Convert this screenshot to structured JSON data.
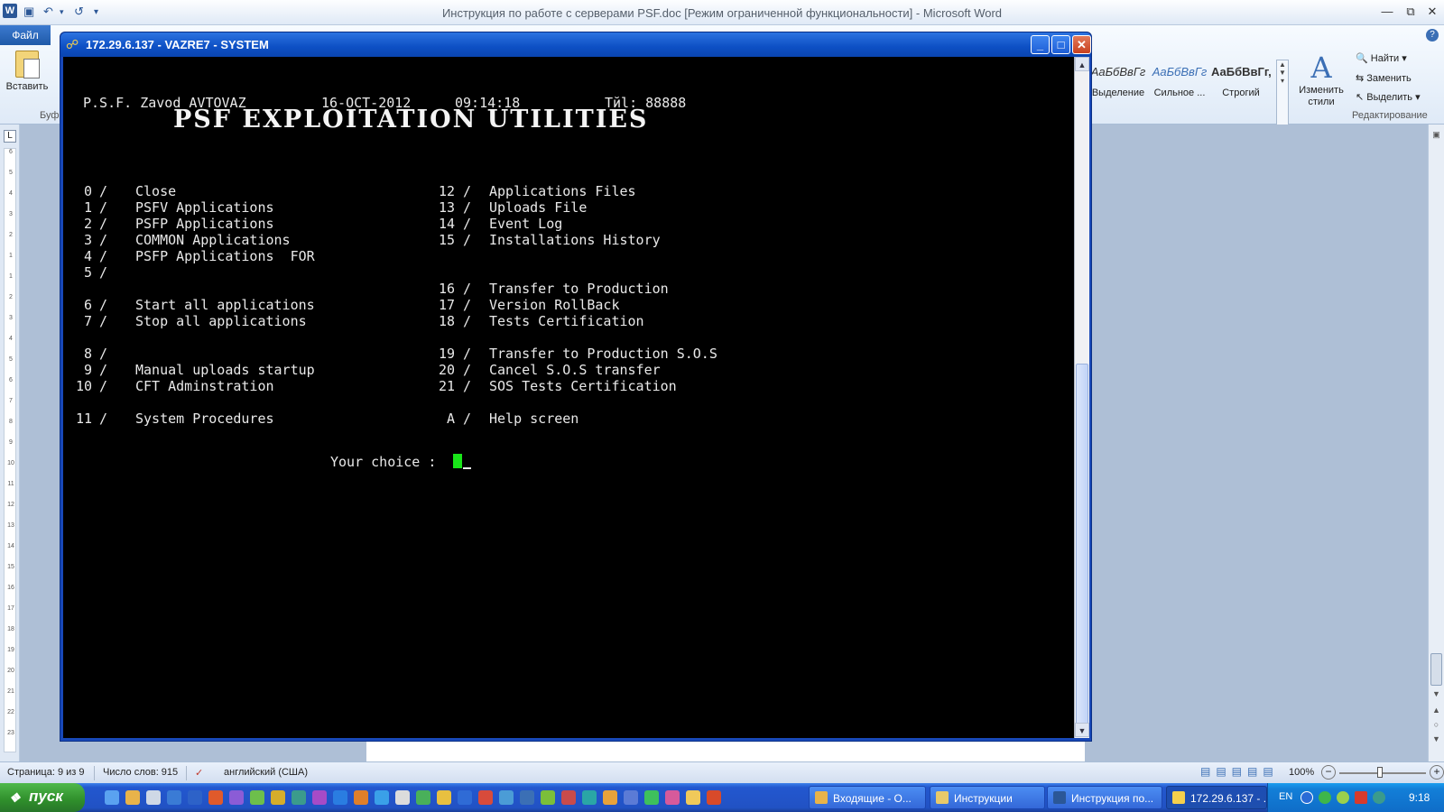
{
  "word": {
    "title": "Инструкция по работе с серверами PSF.doc [Режим ограниченной функциональности]  -  Microsoft Word",
    "file_tab": "Файл",
    "paste_label": "Вставить",
    "clipboard_group": "Буф",
    "styles": [
      {
        "sample": "АаБбВвГг",
        "name": "Выделение"
      },
      {
        "sample": "АаБбВвГг",
        "name": "Сильное ..."
      },
      {
        "sample": "АаБбВвГг,",
        "name": "Строгий"
      }
    ],
    "change_styles": "Изменить стили",
    "edit": {
      "find": "Найти",
      "replace": "Заменить",
      "select": "Выделить",
      "group": "Редактирование"
    },
    "status": {
      "page": "Страница: 9 из 9",
      "words": "Число слов: 915",
      "language": "английский (США)",
      "zoom": "100%"
    },
    "ruler_marks": [
      "6",
      "5",
      "4",
      "3",
      "2",
      "1",
      "1",
      "2",
      "3",
      "4",
      "5",
      "6",
      "7",
      "8",
      "9",
      "10",
      "11",
      "12",
      "13",
      "14",
      "15",
      "16",
      "17",
      "18",
      "19",
      "20",
      "21",
      "22",
      "23"
    ]
  },
  "telnet": {
    "title": "172.29.6.137 - VAZRE7 - SYSTEM",
    "header": {
      "site": "P.S.F. Zavod AVTOVAZ",
      "date": "16-OCT-2012",
      "time": "09:14:18",
      "terminal": "Tйl: 88888"
    },
    "heading": "PSF EXPLOITATION UTILITIES",
    "left_menu": [
      {
        "num": "0",
        "label": "Close"
      },
      {
        "num": "1",
        "label": "PSFV Applications"
      },
      {
        "num": "2",
        "label": "PSFP Applications"
      },
      {
        "num": "3",
        "label": "COMMON Applications"
      },
      {
        "num": "4",
        "label": "PSFP Applications  FOR"
      },
      {
        "num": "5",
        "label": ""
      },
      {
        "num": "6",
        "label": "Start all applications"
      },
      {
        "num": "7",
        "label": "Stop all applications"
      },
      {
        "num": "8",
        "label": ""
      },
      {
        "num": "9",
        "label": "Manual uploads startup"
      },
      {
        "num": "10",
        "label": "CFT Adminstration"
      },
      {
        "num": "11",
        "label": "System Procedures"
      }
    ],
    "right_menu": [
      {
        "num": "12",
        "label": "Applications Files"
      },
      {
        "num": "13",
        "label": "Uploads File"
      },
      {
        "num": "14",
        "label": "Event Log"
      },
      {
        "num": "15",
        "label": "Installations History"
      },
      {
        "num": "16",
        "label": "Transfer to Production"
      },
      {
        "num": "17",
        "label": "Version RollBack"
      },
      {
        "num": "18",
        "label": "Tests Certification"
      },
      {
        "num": "19",
        "label": "Transfer to Production S.O.S"
      },
      {
        "num": "20",
        "label": "Cancel S.O.S transfer"
      },
      {
        "num": "21",
        "label": "SOS Tests Certification"
      },
      {
        "num": "A",
        "label": "Help screen"
      }
    ],
    "slash": "/",
    "prompt": "Your choice :"
  },
  "taskbar": {
    "start": "пуск",
    "tasks": [
      {
        "label": "Входящие - О..."
      },
      {
        "label": "Инструкции"
      },
      {
        "label": "Инструкция по..."
      },
      {
        "label": "172.29.6.137 - ..."
      }
    ],
    "lang": "EN",
    "clock": "9:18"
  },
  "colors": {
    "terminal_bg": "#000000",
    "terminal_text": "#e9e9e9",
    "cursor": "#19e619",
    "xp_titlebar": "#0d4fc4",
    "start_green": "#2f8e2b"
  }
}
